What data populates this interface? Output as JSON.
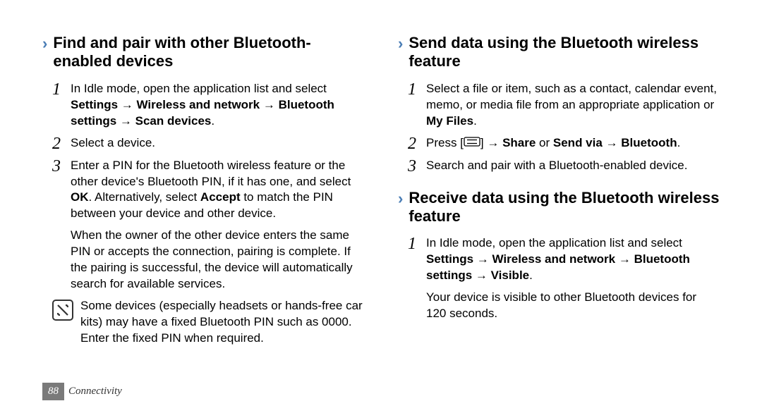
{
  "left": {
    "heading": "Find and pair with other Bluetooth-enabled devices",
    "step1_a": "In Idle mode, open the application list and select ",
    "step1_b": "Settings → Wireless and network → Bluetooth settings → Scan devices",
    "step1_c": ".",
    "step2": "Select a device.",
    "step3_a": "Enter a PIN for the Bluetooth wireless feature or the other device's Bluetooth PIN, if it has one, and select ",
    "step3_b": "OK",
    "step3_c": ". Alternatively, select ",
    "step3_d": "Accept",
    "step3_e": " to match the PIN between your device and other device.",
    "step3_cont": "When the owner of the other device enters the same PIN or accepts the connection, pairing is complete. If the pairing is successful, the device will automatically search for available services.",
    "note": "Some devices (especially headsets or hands-free car kits) may have a fixed Bluetooth PIN such as 0000. Enter the fixed PIN when required."
  },
  "right": {
    "heading1": "Send data using the Bluetooth wireless feature",
    "r1_step1_a": "Select a file or item, such as a contact, calendar event, memo, or media file from an appropriate application or ",
    "r1_step1_b": "My Files",
    "r1_step1_c": ".",
    "r1_step2_a": "Press [",
    "r1_step2_b": "] → ",
    "r1_step2_c": "Share",
    "r1_step2_d": " or ",
    "r1_step2_e": "Send via",
    "r1_step2_f": " → ",
    "r1_step2_g": "Bluetooth",
    "r1_step2_h": ".",
    "r1_step3": "Search and pair with a Bluetooth-enabled device.",
    "heading2": "Receive data using the Bluetooth wireless feature",
    "r2_step1_a": "In Idle mode, open the application list and select ",
    "r2_step1_b": "Settings → Wireless and network → Bluetooth settings → Visible",
    "r2_step1_c": ".",
    "r2_step1_cont": "Your device is visible to other Bluetooth devices for 120 seconds."
  },
  "footer": {
    "page": "88",
    "section": "Connectivity"
  },
  "nums": {
    "n1": "1",
    "n2": "2",
    "n3": "3"
  }
}
